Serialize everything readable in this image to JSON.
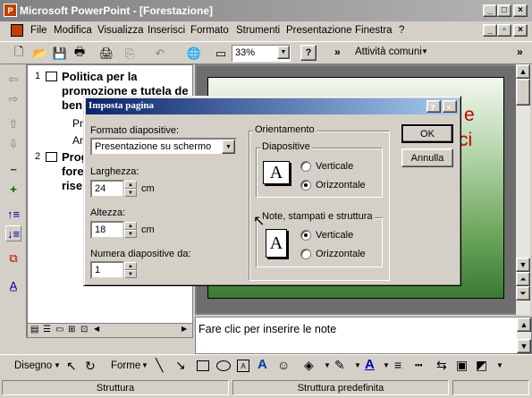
{
  "window": {
    "title": "Microsoft PowerPoint - [Forestazione]",
    "app_icon": "powerpoint-icon",
    "controls": [
      "_",
      "□",
      "×"
    ]
  },
  "menu": {
    "items": [
      "File",
      "Modifica",
      "Visualizza",
      "Inserisci",
      "Formato",
      "Strumenti",
      "Presentazione",
      "Finestra",
      "?"
    ],
    "doc_controls": [
      "_",
      "▫",
      "×"
    ]
  },
  "toolbar": {
    "zoom": "33%",
    "help": "?",
    "more": "»",
    "tasks_label": "Attività comuni",
    "chevron": "»"
  },
  "outline": {
    "slide1": {
      "num": "1",
      "title_line1": "Politica per la",
      "title_line2": "promozione e tutela de",
      "title_line3": "ben",
      "sub1": "Pr",
      "sub2": "Ar"
    },
    "slide2": {
      "num": "2",
      "title_line1": "Prog",
      "title_line2": "fore",
      "title_line3": "rise"
    }
  },
  "slide": {
    "peek_line1": "e",
    "peek_line2": "ci"
  },
  "notes": {
    "placeholder": "Fare clic per inserire le note"
  },
  "drawbar": {
    "draw_label": "Disegno",
    "shapes_label": "Forme"
  },
  "status": {
    "left": "Struttura",
    "middle": "Struttura predefinita"
  },
  "dialog": {
    "title": "Imposta pagina",
    "help": "?",
    "close": "×",
    "format_label": "Formato diapositive:",
    "format_value": "Presentazione su schermo",
    "width_label": "Larghezza:",
    "width_value": "24",
    "width_unit": "cm",
    "height_label": "Altezza:",
    "height_value": "18",
    "height_unit": "cm",
    "number_label": "Numera diapositive da:",
    "number_value": "1",
    "orientation_group": "Orientamento",
    "slides_group": "Diapositive",
    "notes_group": "Note, stampati e struttura",
    "vertical": "Verticale",
    "horizontal": "Orizzontale",
    "slides_selected": "horizontal",
    "notes_selected": "vertical",
    "ok": "OK",
    "cancel": "Annulla",
    "icon_letter": "A"
  }
}
